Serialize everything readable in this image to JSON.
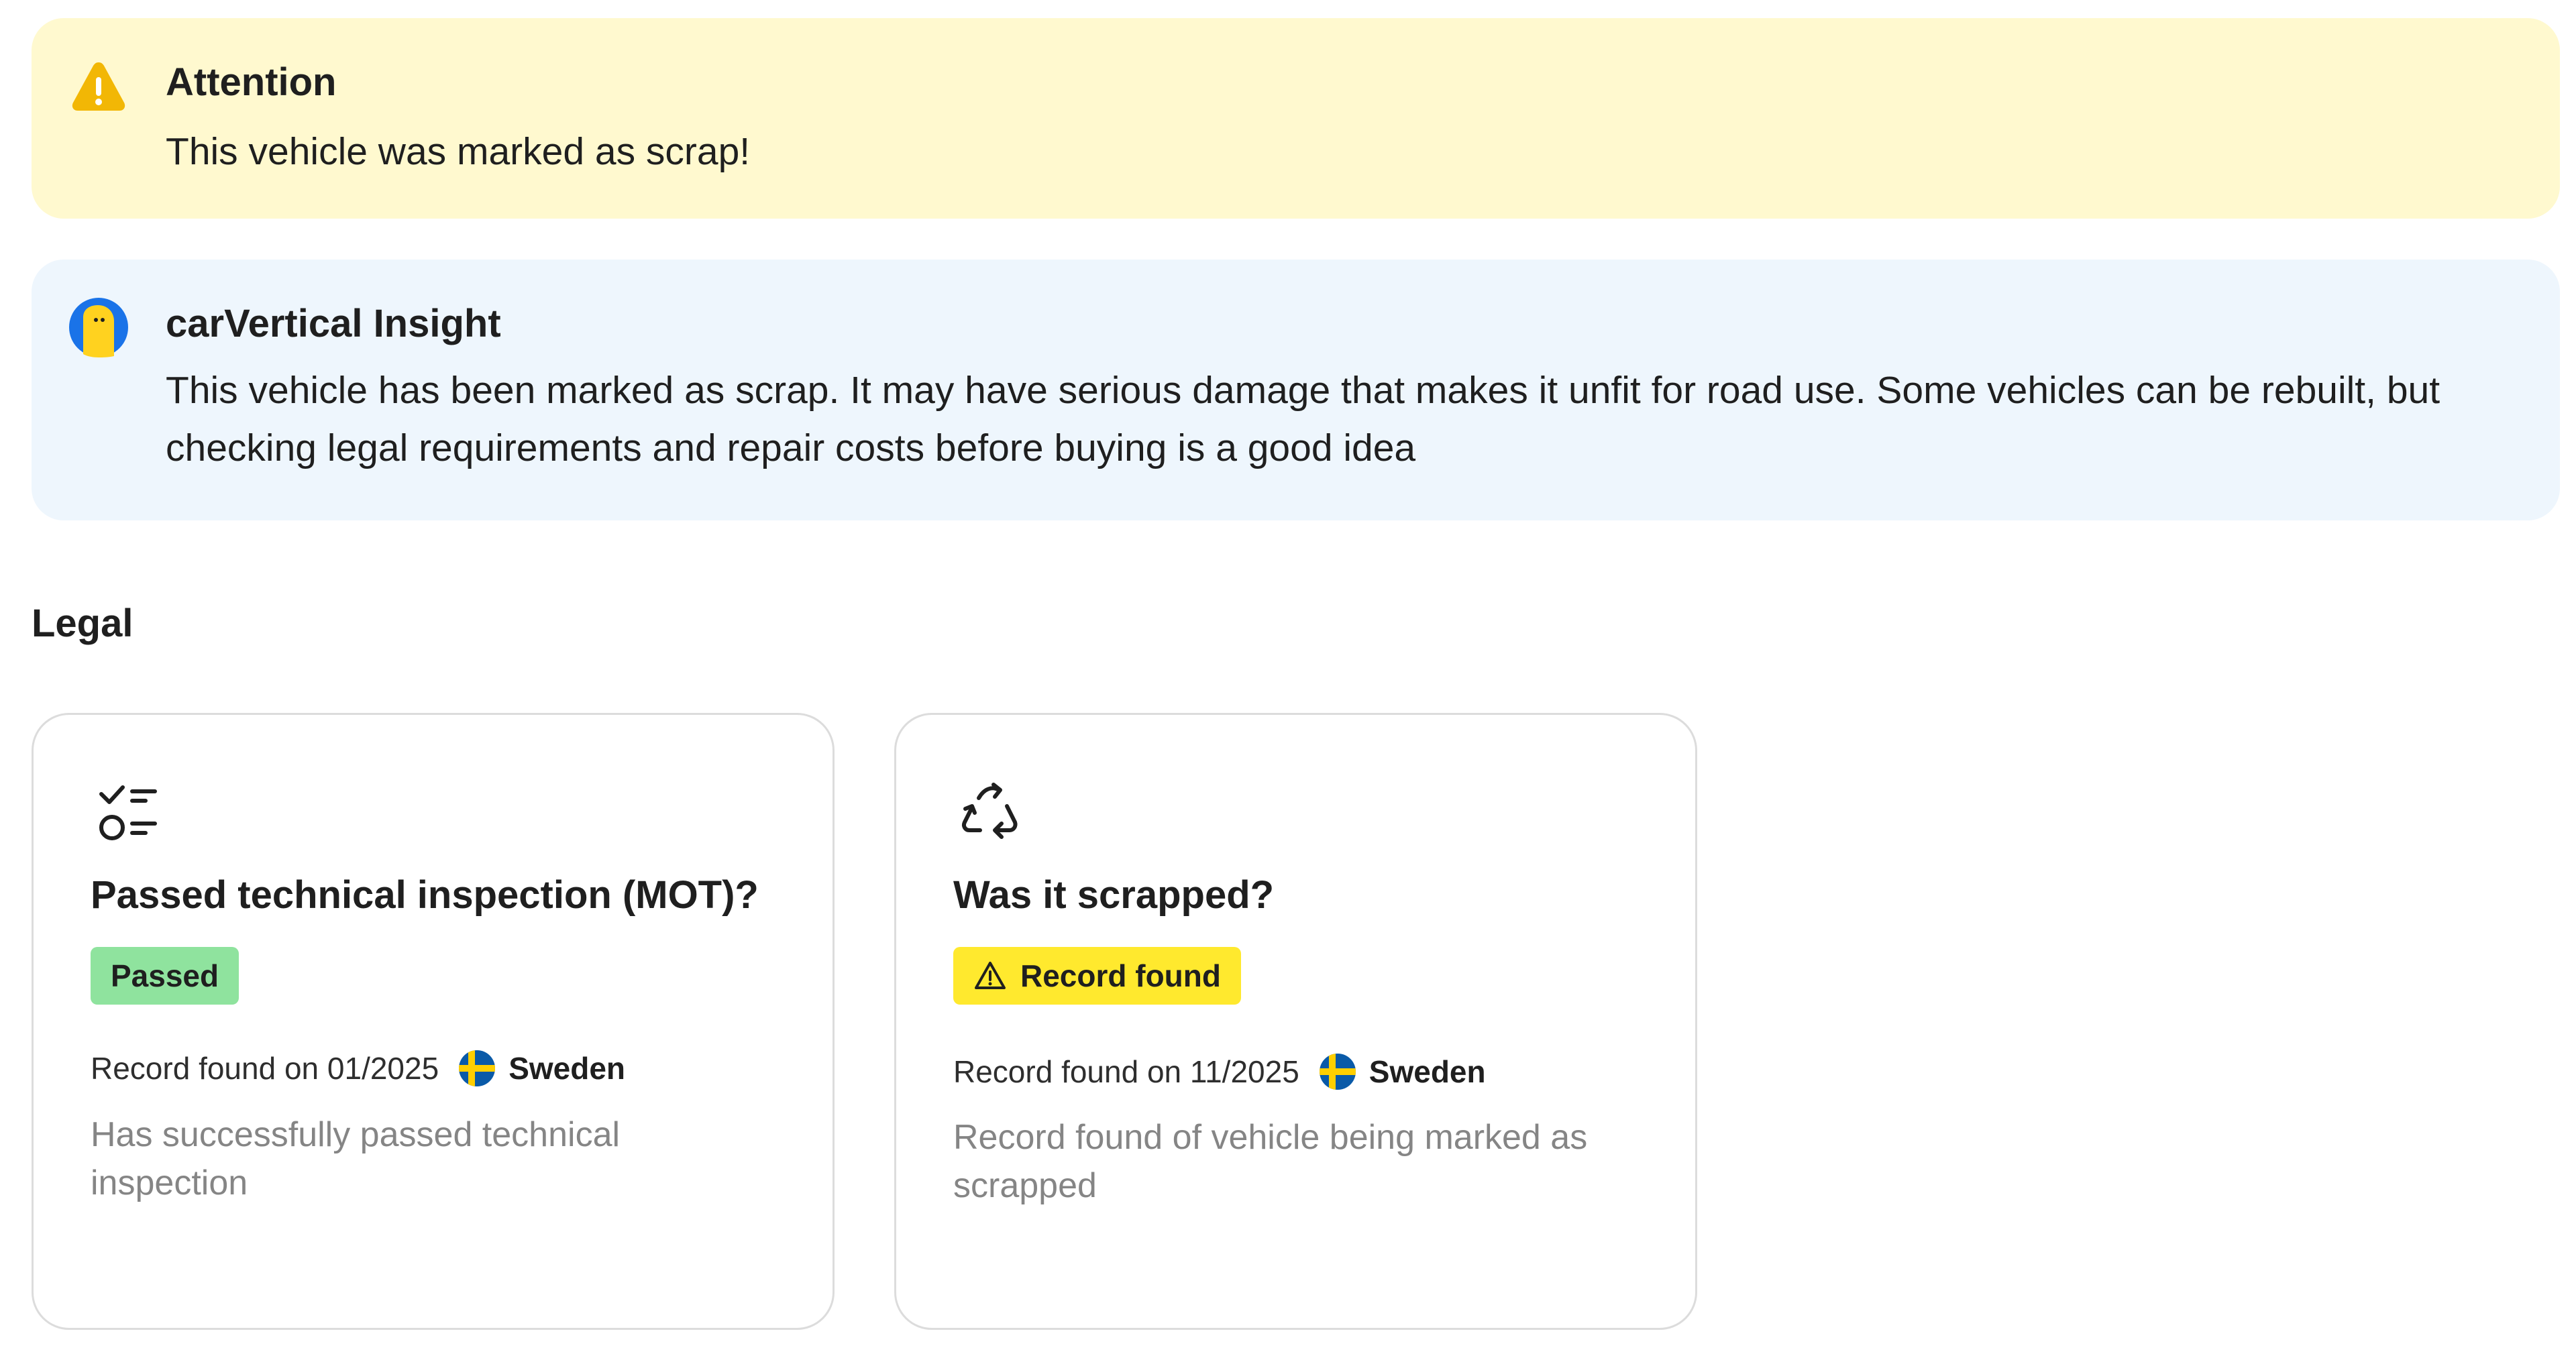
{
  "attention": {
    "title": "Attention",
    "message": "This vehicle was marked as scrap!",
    "icon": "warning-icon",
    "color": "#f2b705"
  },
  "insight": {
    "title": "carVertical Insight",
    "message": "This vehicle has been marked as scrap. It may have serious damage that makes it unfit for road use. Some vehicles can be rebuilt, but checking legal requirements and repair costs before buying is a good idea",
    "icon": "carvertical-mascot-icon",
    "color": "#1a73e8"
  },
  "legal": {
    "section_title": "Legal",
    "cards": [
      {
        "icon": "checklist-icon",
        "title": "Passed technical inspection (MOT)?",
        "badge": "Passed",
        "badge_color": "#8fe39e",
        "record_text": "Record found on 01/2025",
        "country": "Sweden",
        "flag_icon": "sweden-flag-icon",
        "description": "Has successfully passed technical inspection"
      },
      {
        "icon": "recycle-icon",
        "title": "Was it scrapped?",
        "badge": "Record found",
        "badge_icon": "warning-triangle-icon",
        "badge_color": "#ffe92e",
        "record_text": "Record found on 11/2025",
        "country": "Sweden",
        "flag_icon": "sweden-flag-icon",
        "description": "Record found of vehicle being marked as scrapped"
      }
    ]
  }
}
